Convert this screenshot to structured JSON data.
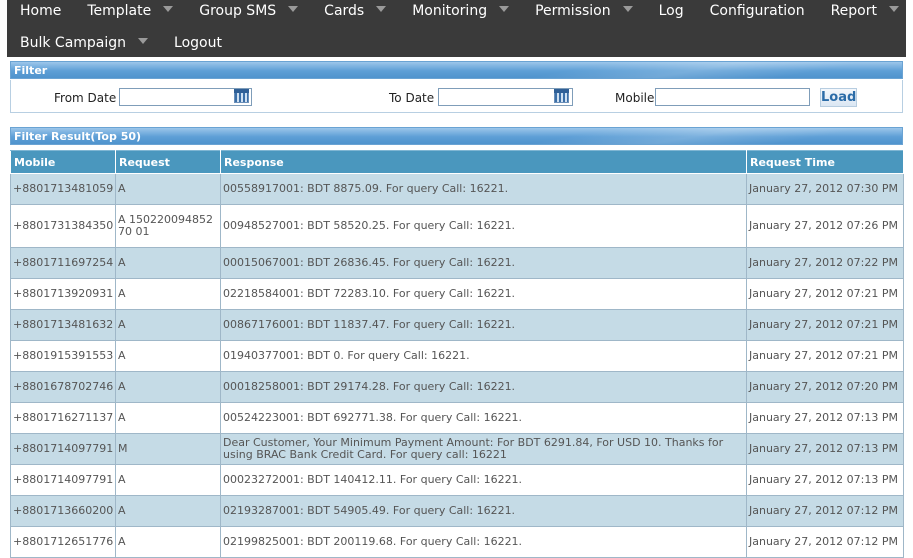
{
  "nav": {
    "row1": [
      {
        "label": "Home",
        "dropdown": false
      },
      {
        "label": "Template",
        "dropdown": true
      },
      {
        "label": "Group SMS",
        "dropdown": true
      },
      {
        "label": "Cards",
        "dropdown": true
      },
      {
        "label": "Monitoring",
        "dropdown": true
      },
      {
        "label": "Permission",
        "dropdown": true
      },
      {
        "label": "Log",
        "dropdown": false
      },
      {
        "label": "Configuration",
        "dropdown": false
      },
      {
        "label": "Report",
        "dropdown": true
      }
    ],
    "row2": [
      {
        "label": "Bulk Campaign",
        "dropdown": true
      },
      {
        "label": "Logout",
        "dropdown": false
      }
    ]
  },
  "filter": {
    "title": "Filter",
    "from_date_label": "From Date",
    "from_date_value": "",
    "to_date_label": "To Date",
    "to_date_value": "",
    "mobile_label": "Mobile",
    "mobile_value": "",
    "load_label": "Load"
  },
  "results": {
    "title": "Filter Result(Top 50)",
    "columns": [
      "Mobile",
      "Request",
      "Response",
      "Request Time"
    ],
    "rows": [
      {
        "mobile": "+8801713481059",
        "request": "A",
        "response": "00558917001: BDT 8875.09. For query Call: 16221.",
        "time": "January 27, 2012 07:30 PM"
      },
      {
        "mobile": "+8801731384350",
        "request": "A 15022009485270 01",
        "response": "00948527001: BDT 58520.25. For query Call: 16221.",
        "time": "January 27, 2012 07:26 PM"
      },
      {
        "mobile": "+8801711697254",
        "request": "A",
        "response": "00015067001: BDT 26836.45. For query Call: 16221.",
        "time": "January 27, 2012 07:22 PM"
      },
      {
        "mobile": "+8801713920931",
        "request": "A",
        "response": "02218584001: BDT 72283.10. For query Call: 16221.",
        "time": "January 27, 2012 07:21 PM"
      },
      {
        "mobile": "+8801713481632",
        "request": "A",
        "response": "00867176001: BDT 11837.47. For query Call: 16221.",
        "time": "January 27, 2012 07:21 PM"
      },
      {
        "mobile": "+8801915391553",
        "request": "A",
        "response": "01940377001: BDT 0. For query Call: 16221.",
        "time": "January 27, 2012 07:21 PM"
      },
      {
        "mobile": "+8801678702746",
        "request": "A",
        "response": "00018258001: BDT 29174.28. For query Call: 16221.",
        "time": "January 27, 2012 07:20 PM"
      },
      {
        "mobile": "+8801716271137",
        "request": "A",
        "response": "00524223001: BDT 692771.38. For query Call: 16221.",
        "time": "January 27, 2012 07:13 PM"
      },
      {
        "mobile": "+8801714097791",
        "request": "M",
        "response": "Dear Customer, Your Minimum Payment Amount: For BDT 6291.84, For USD 10. Thanks for using BRAC Bank Credit Card. For query call: 16221",
        "time": "January 27, 2012 07:13 PM"
      },
      {
        "mobile": "+8801714097791",
        "request": "A",
        "response": "00023272001: BDT 140412.11. For query Call: 16221.",
        "time": "January 27, 2012 07:13 PM"
      },
      {
        "mobile": "+8801713660200",
        "request": "A",
        "response": "02193287001: BDT 54905.49. For query Call: 16221.",
        "time": "January 27, 2012 07:12 PM"
      },
      {
        "mobile": "+8801712651776",
        "request": "A",
        "response": "02199825001: BDT 200119.68. For query Call: 16221.",
        "time": "January 27, 2012 07:12 PM"
      }
    ]
  }
}
